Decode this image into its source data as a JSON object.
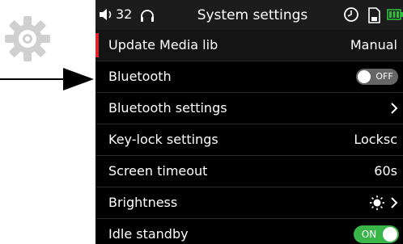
{
  "status_bar": {
    "volume_icon": "speaker-icon",
    "volume": "32",
    "headphones_icon": "headphones-icon",
    "title": "System settings",
    "clock_icon": "clock-icon",
    "sd_icon": "sd-card-icon",
    "battery_icon": "battery-icon",
    "battery_color": "#2fbf3f"
  },
  "menu": {
    "update_media_lib": {
      "label": "Update Media lib",
      "value": "Manual"
    },
    "bluetooth": {
      "label": "Bluetooth",
      "toggle_text": "OFF"
    },
    "bluetooth_settings": {
      "label": "Bluetooth settings",
      "icon": "chevron-right-icon"
    },
    "key_lock": {
      "label": "Key-lock settings",
      "value": "Locksc"
    },
    "screen_timeout": {
      "label": "Screen timeout",
      "value": "60s"
    },
    "brightness": {
      "label": "Brightness",
      "icon": "sun-icon"
    },
    "idle_standby": {
      "label": "Idle standby",
      "toggle_text": "ON"
    }
  },
  "colors": {
    "selected_marker": "#e0262a",
    "toggle_on": "#39b54a",
    "toggle_off": "#666666"
  },
  "annotations": {
    "gear_icon": "gear-icon",
    "arrow_icon": "arrow-right-icon"
  }
}
